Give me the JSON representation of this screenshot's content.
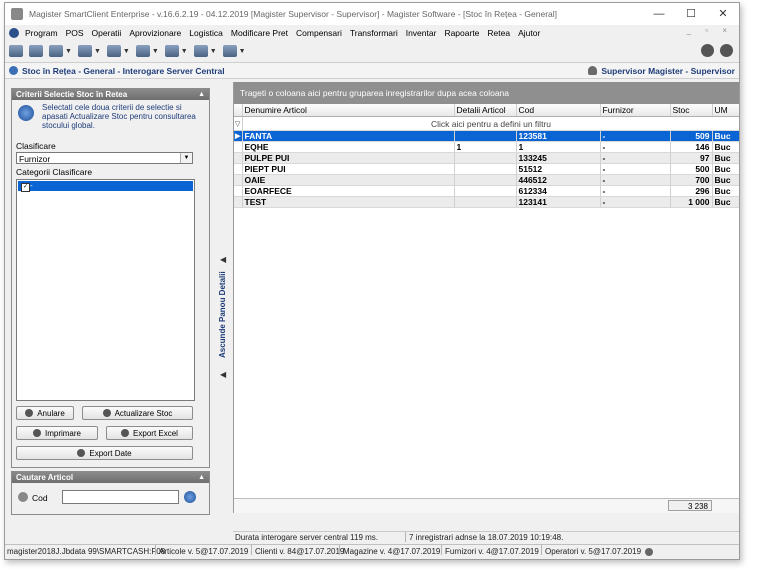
{
  "window": {
    "title": "Magister SmartClient Enterprise - v.16.6.2.19 - 04.12.2019 [Magister Supervisor - Supervisor] - Magister Software - [Stoc în Rețea - General]",
    "controls": [
      "—",
      "☐",
      "✕"
    ]
  },
  "menu": {
    "items": [
      "Program",
      "POS",
      "Operatii",
      "Aprovizionare",
      "Logistica",
      "Modificare Pret",
      "Compensari",
      "Transformari",
      "Inventar",
      "Rapoarte",
      "Retea",
      "Ajutor"
    ],
    "right_controls": "_ ▫ ×"
  },
  "toolbar": {
    "icons": [
      "folder-icon",
      "cash-register-icon",
      "users-icon",
      "truck-icon",
      "document-icon",
      "monitor-icon",
      "report-icon",
      "globe-icon",
      "exit-icon"
    ]
  },
  "location": {
    "path": "Stoc în Rețea - General - Interogare Server Central",
    "user": "Supervisor Magister - Supervisor"
  },
  "criteria": {
    "header": "Criterii Selectie Stoc în Retea",
    "info": "Selectati cele doua criterii de selectie si apasati Actualizare Stoc pentru consultarea stocului global.",
    "clasificare_label": "Clasificare",
    "clasificare_value": "Furnizor",
    "categorii_label": "Categorii Clasificare",
    "categorii_item": "-",
    "buttons": {
      "anulare": "Anulare",
      "actualizare": "Actualizare Stoc",
      "imprimare": "Imprimare",
      "export_excel": "Export Excel",
      "export_date": "Export Date"
    }
  },
  "search": {
    "header": "Cautare Articol",
    "label": "Cod",
    "value": ""
  },
  "splitter": {
    "label": "Ascunde Panou Detalii"
  },
  "grid": {
    "group_hint": "Trageti o coloana aici pentru gruparea inregistrarilor dupa acea coloana",
    "filter_hint": "Click aici pentru a defini un filtru",
    "columns": [
      "Denumire Articol",
      "Detalii Articol",
      "Cod",
      "Furnizor",
      "Stoc",
      "UM"
    ],
    "rows": [
      {
        "name": "FANTA",
        "detail": "",
        "code": "123581",
        "supplier": "-",
        "stock": "509",
        "um": "Buc"
      },
      {
        "name": "EQHE",
        "detail": "1",
        "code": "1",
        "supplier": "-",
        "stock": "146",
        "um": "Buc"
      },
      {
        "name": "PULPE PUI",
        "detail": "",
        "code": "133245",
        "supplier": "-",
        "stock": "97",
        "um": "Buc"
      },
      {
        "name": "PIEPT PUI",
        "detail": "",
        "code": "51512",
        "supplier": "-",
        "stock": "500",
        "um": "Buc"
      },
      {
        "name": "OAIE",
        "detail": "",
        "code": "446512",
        "supplier": "-",
        "stock": "700",
        "um": "Buc"
      },
      {
        "name": "EOARFECE",
        "detail": "",
        "code": "612334",
        "supplier": "-",
        "stock": "296",
        "um": "Buc"
      },
      {
        "name": "TEST",
        "detail": "",
        "code": "123141",
        "supplier": "-",
        "stock": "1 000",
        "um": "Buc"
      }
    ],
    "total": "3 238"
  },
  "status": {
    "query_duration": "Durata interogare server central 119 ms.",
    "records": "7 inregistrari adnse la 18.07.2019 10:19:48.",
    "bottom": [
      "magister2018J.Jbdata 99\\SMARTCASH:F08",
      "Articole v. 5@17.07.2019",
      "Clienti v. 84@17.07.2019",
      "Magazine v. 4@17.07.2019",
      "Furnizori v. 4@17.07.2019",
      "Operatori v. 5@17.07.2019"
    ]
  }
}
